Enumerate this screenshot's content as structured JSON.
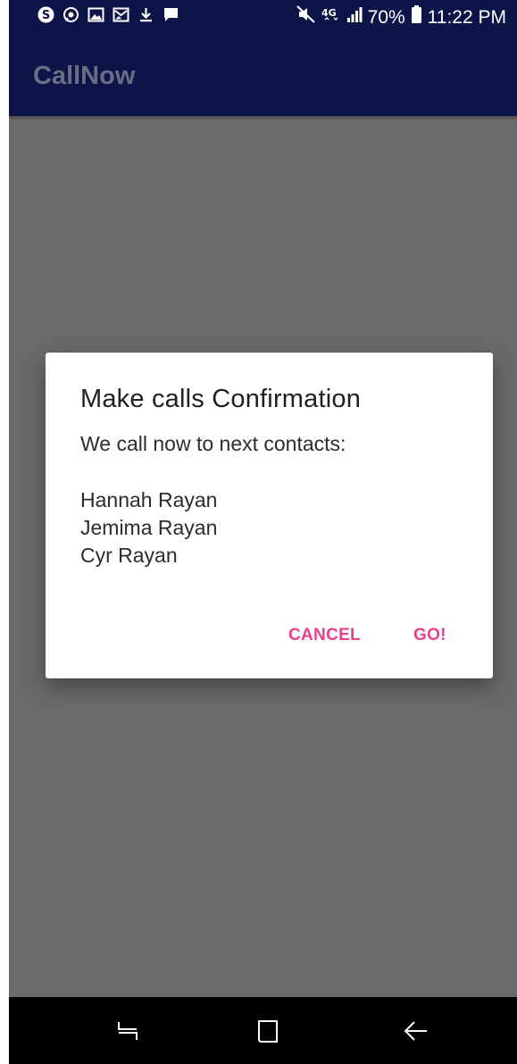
{
  "status_bar": {
    "battery_percent": "70%",
    "time": "11:22 PM",
    "network": "4G",
    "notification_icons": [
      "skype-icon",
      "whatsapp-icon",
      "gallery-icon",
      "gallery-icon-2",
      "download-icon",
      "message-icon"
    ],
    "system_icons": [
      "mute-icon",
      "4g-icon",
      "signal-icon",
      "battery-icon"
    ]
  },
  "app_bar": {
    "title": "CallNow"
  },
  "dialog": {
    "title": "Make calls Confirmation",
    "message": "We call now to next contacts:",
    "contacts": [
      "Hannah Rayan",
      "Jemima Rayan",
      "Cyr Rayan"
    ],
    "cancel_label": "CANCEL",
    "confirm_label": "GO!"
  },
  "nav_bar": {
    "icons": [
      "recents-icon",
      "home-icon",
      "back-icon"
    ]
  },
  "colors": {
    "app_bar": "#0d1447",
    "scrim": "#6a6a6a",
    "accent": "#ea3f8a",
    "dialog_bg": "#ffffff"
  }
}
